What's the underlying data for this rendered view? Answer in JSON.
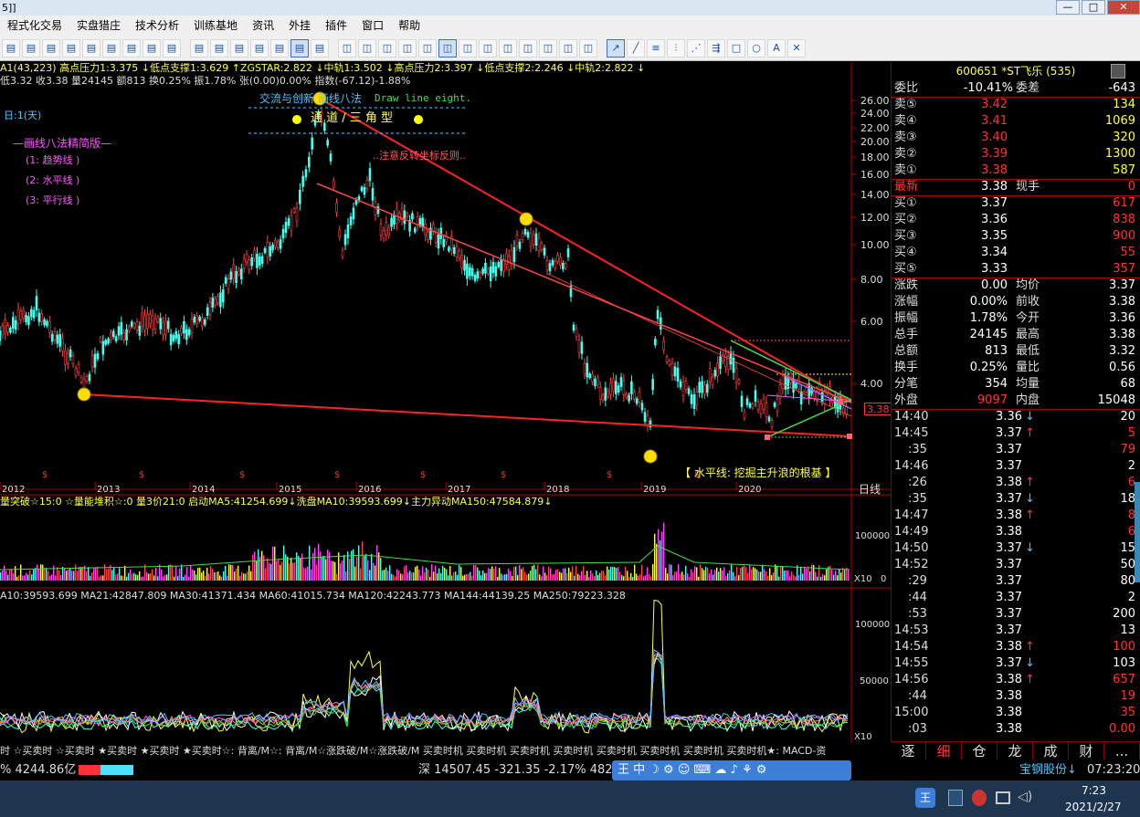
{
  "window": {
    "title": "5]]",
    "minimize": "—",
    "maximize": "□",
    "close": "✕"
  },
  "menu": [
    "程式化交易",
    "实盘猎庄",
    "技术分析",
    "训练基地",
    "资讯",
    "外挂",
    "插件",
    "窗口",
    "帮助"
  ],
  "toolbar": {
    "icons": [
      "chart-icon",
      "table-icon",
      "copy-icon",
      "list-icon",
      "buy-icon",
      "sell-icon",
      "warn-icon",
      "pie-icon",
      "grid-icon",
      "kline-icon",
      "bars-icon",
      "line-icon",
      "stack-icon",
      "doc-icon",
      "win-icon",
      "win2-icon",
      "period-1",
      "period-5",
      "period-15",
      "period-30",
      "period-60",
      "period-day",
      "period-week",
      "period-month",
      "period-season",
      "period-year",
      "period-m",
      "period-d",
      "period-w"
    ],
    "draw_icons": [
      "draw-line-icon",
      "draw-trend-icon",
      "draw-hline-icon",
      "draw-channel-icon",
      "draw-fib-icon",
      "draw-arrow-icon",
      "draw-rect-icon",
      "draw-circle-icon",
      "draw-text-icon",
      "draw-delete-icon"
    ],
    "text_icon": "A·"
  },
  "chart": {
    "info1": "A1(43,223) 高点压力1:3.375 ↓低点支撑1:3.629 ↑ZGSTAR:2.822 ↓中轨1:3.502 ↓高点压力2:3.397 ↓低点支撑2:2.246 ↓中轨2:2.822 ↓",
    "info2": "低3.32 收3.38 量24145 额813 换0.25% 振1.78% 张(0.00)0.00% 指数(-67.12)-1.88%",
    "period_label": "日:1(天)",
    "panel_title": "—画线八法精简版—",
    "panel_items": [
      "(1: 趋势线 )",
      "(2: 水平线 )",
      "(3: 平行线 )"
    ],
    "banner_title": "交流与创新 画线八法",
    "banner_english": "Draw line eight.",
    "banner_sub": "通  道 / 三 角  型",
    "note_text": "..注意反转坐标反则..",
    "bottom_note": "【 水平线: 挖掘主升浪的根基 】",
    "price_ticks": [
      "26.00",
      "24.00",
      "22.00",
      "20.00",
      "18.00",
      "16.00",
      "14.00",
      "12.00",
      "10.00",
      "8.00",
      "6.00",
      "4.00"
    ],
    "current_price": "3.38",
    "years": [
      "2012",
      "2013",
      "2014",
      "2015",
      "2016",
      "2017",
      "2018",
      "2019",
      "2020"
    ],
    "day_line": "日线",
    "vol_info": "量突破☆15:0 ☆量能堆积☆:0 量3价21:0 启动MA5:41254.699↓洗盘MA10:39593.699↓主力异动MA150:47584.879↓",
    "vol_tick": "100000",
    "vol_zero": "0",
    "vol_unit": "X10",
    "ma_info": "A10:39593.699 MA21:42847.809 MA30:41371.434 MA60:41015.734 MA120:42243.773 MA144:44139.25 MA250:79223.328",
    "ma_ticks": [
      "100000",
      "50000"
    ],
    "ma_unit": "X10",
    "signal_strip": "时 ☆买卖时 ☆买卖时 ★买卖时 ★买卖时 ★买卖时☆: 背离/M☆: 背离/M☆涨跌破/M☆涨跌破/M 买卖时机 买卖时机 买卖时机 买卖时机 买卖时机 买卖时机 买卖时机 买卖时机★: MACD-资"
  },
  "quote": {
    "code": "600651",
    "name": "*ST飞乐",
    "count": "(535)",
    "weibi_label": "委比",
    "weibi_value": "-10.41%",
    "weicha_label": "委差",
    "weicha_value": "-643",
    "sells": [
      {
        "label": "卖⑤",
        "price": "3.42",
        "vol": "134"
      },
      {
        "label": "卖④",
        "price": "3.41",
        "vol": "1069"
      },
      {
        "label": "卖③",
        "price": "3.40",
        "vol": "320"
      },
      {
        "label": "卖②",
        "price": "3.39",
        "vol": "1300"
      },
      {
        "label": "卖①",
        "price": "3.38",
        "vol": "587"
      }
    ],
    "latest_label": "最新",
    "latest_value": "3.38",
    "xianshou_label": "现手",
    "xianshou_value": "0",
    "buys": [
      {
        "label": "买①",
        "price": "3.37",
        "vol": "617"
      },
      {
        "label": "买②",
        "price": "3.36",
        "vol": "838"
      },
      {
        "label": "买③",
        "price": "3.35",
        "vol": "900"
      },
      {
        "label": "买④",
        "price": "3.34",
        "vol": "55"
      },
      {
        "label": "买⑤",
        "price": "3.33",
        "vol": "357"
      }
    ],
    "stats": [
      {
        "l1": "涨跌",
        "v1": "0.00",
        "l2": "均价",
        "v2": "3.37"
      },
      {
        "l1": "涨幅",
        "v1": "0.00%",
        "l2": "前收",
        "v2": "3.38"
      },
      {
        "l1": "振幅",
        "v1": "1.78%",
        "l2": "今开",
        "v2": "3.36"
      },
      {
        "l1": "总手",
        "v1": "24145",
        "l2": "最高",
        "v2": "3.38"
      },
      {
        "l1": "总额",
        "v1": "813",
        "l2": "最低",
        "v2": "3.32"
      },
      {
        "l1": "换手",
        "v1": "0.25%",
        "l2": "量比",
        "v2": "0.56"
      },
      {
        "l1": "分笔",
        "v1": "354",
        "l2": "均量",
        "v2": "68"
      }
    ],
    "waipan_label": "外盘",
    "waipan_value": "9097",
    "neipan_label": "内盘",
    "neipan_value": "15048",
    "ticks": [
      {
        "time": "14:40",
        "price": "3.36",
        "arrow": "↓",
        "vol": "20",
        "vc": "#fff"
      },
      {
        "time": "14:45",
        "price": "3.37",
        "arrow": "↑",
        "vol": "5",
        "vc": "#ff3333"
      },
      {
        "time": ":35",
        "price": "3.37",
        "arrow": "",
        "vol": "79",
        "vc": "#ff3333"
      },
      {
        "time": "14:46",
        "price": "3.37",
        "arrow": "",
        "vol": "2",
        "vc": "#fff"
      },
      {
        "time": ":26",
        "price": "3.38",
        "arrow": "↑",
        "vol": "6",
        "vc": "#ff3333"
      },
      {
        "time": ":35",
        "price": "3.37",
        "arrow": "↓",
        "vol": "18",
        "vc": "#fff"
      },
      {
        "time": "14:47",
        "price": "3.38",
        "arrow": "↑",
        "vol": "8",
        "vc": "#ff3333"
      },
      {
        "time": "14:49",
        "price": "3.38",
        "arrow": "",
        "vol": "6",
        "vc": "#ff3333"
      },
      {
        "time": "14:50",
        "price": "3.37",
        "arrow": "↓",
        "vol": "15",
        "vc": "#fff"
      },
      {
        "time": "14:52",
        "price": "3.37",
        "arrow": "",
        "vol": "50",
        "vc": "#fff"
      },
      {
        "time": ":29",
        "price": "3.37",
        "arrow": "",
        "vol": "80",
        "vc": "#fff"
      },
      {
        "time": ":44",
        "price": "3.37",
        "arrow": "",
        "vol": "2",
        "vc": "#fff"
      },
      {
        "time": ":53",
        "price": "3.37",
        "arrow": "",
        "vol": "200",
        "vc": "#fff"
      },
      {
        "time": "14:53",
        "price": "3.37",
        "arrow": "",
        "vol": "13",
        "vc": "#fff"
      },
      {
        "time": "14:54",
        "price": "3.38",
        "arrow": "↑",
        "vol": "100",
        "vc": "#ff3333"
      },
      {
        "time": "14:55",
        "price": "3.37",
        "arrow": "↓",
        "vol": "103",
        "vc": "#fff"
      },
      {
        "time": "14:56",
        "price": "3.38",
        "arrow": "↑",
        "vol": "657",
        "vc": "#ff3333"
      },
      {
        "time": ":44",
        "price": "3.38",
        "arrow": "",
        "vol": "19",
        "vc": "#ff3333"
      },
      {
        "time": "15:00",
        "price": "3.38",
        "arrow": "",
        "vol": "35",
        "vc": "#ff3333"
      },
      {
        "time": ":03",
        "price": "3.38",
        "arrow": "",
        "vol": "0.00",
        "vc": "#ff3333"
      }
    ],
    "tabs": [
      "逐",
      "细",
      "仓",
      "龙",
      "成",
      "财",
      "..."
    ]
  },
  "statusbar": {
    "left": "% 4244.86亿",
    "index": "深 14507.45 -321.35 -2.17% 482",
    "right_tag": "宝钢股份↓",
    "time": "07:23:20"
  },
  "taskbar": {
    "clock_time": "7:23",
    "clock_date": "2021/2/27"
  }
}
